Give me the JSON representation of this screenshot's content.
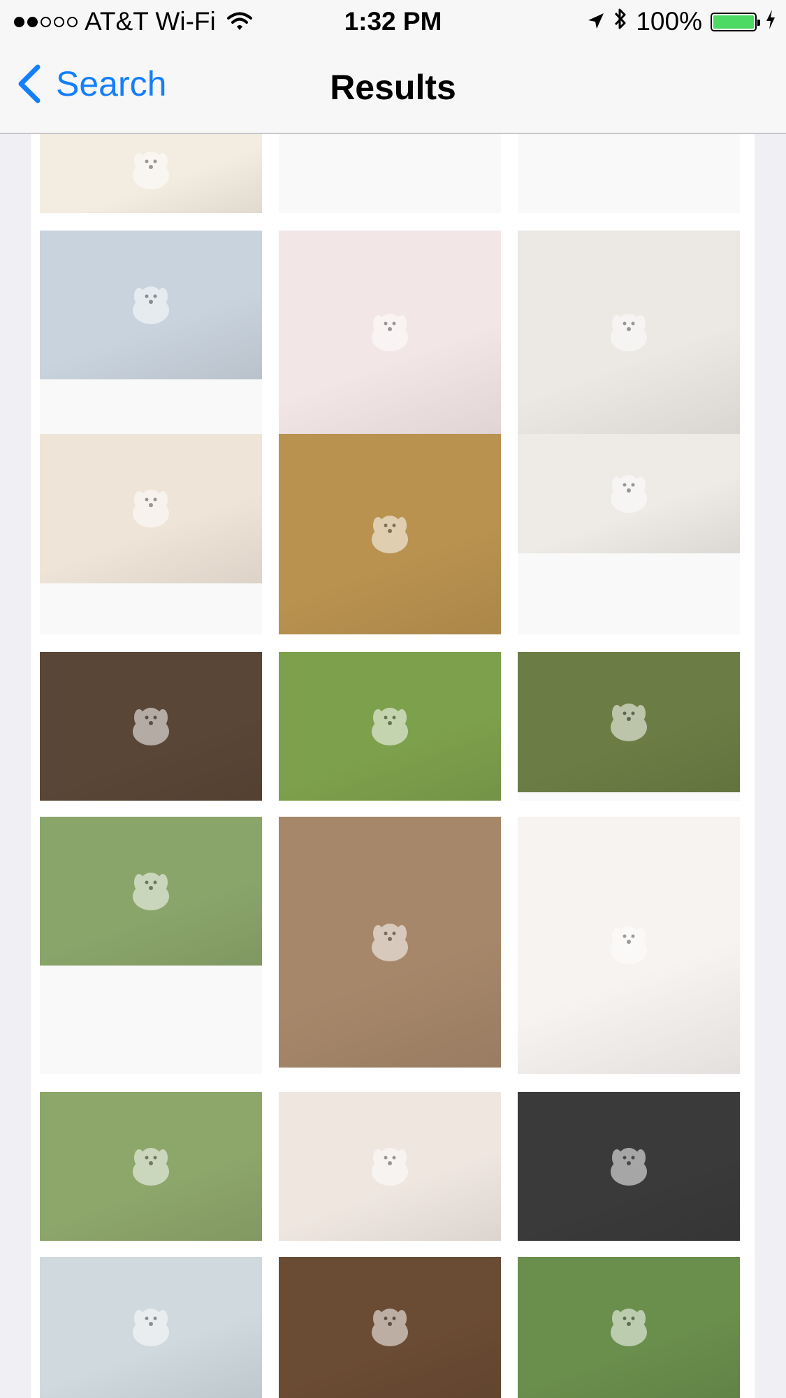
{
  "status_bar": {
    "carrier": "AT&T Wi-Fi",
    "time": "1:32 PM",
    "battery": "100%",
    "signal_bars_filled": 2,
    "signal_bars_total": 5
  },
  "nav_bar": {
    "back_label": "Search",
    "title": "Results"
  },
  "colors": {
    "accent": "#147efb",
    "battery": "#4cd964",
    "page_bg": "#efeff4"
  },
  "results": [
    {
      "name": "puppy-sitting-cream",
      "icon": "dog-icon"
    },
    {
      "name": "placeholder-blank-1",
      "icon": "dog-icon"
    },
    {
      "name": "placeholder-blank-2",
      "icon": "dog-icon"
    },
    {
      "name": "beagle-puppy",
      "icon": "dog-icon"
    },
    {
      "name": "labrador-puppies-in-basket",
      "icon": "dog-icon"
    },
    {
      "name": "australian-shepherd-puppy",
      "icon": "dog-icon"
    },
    {
      "name": "sleeping-puppies",
      "icon": "dog-icon"
    },
    {
      "name": "golden-retriever-with-puppies",
      "icon": "dog-icon"
    },
    {
      "name": "kitten-and-puppy",
      "icon": "dog-icon"
    },
    {
      "name": "golden-retriever-lying",
      "icon": "dog-icon"
    },
    {
      "name": "golden-puppy-in-grass",
      "icon": "dog-icon"
    },
    {
      "name": "brown-poodle-puppy",
      "icon": "dog-icon"
    },
    {
      "name": "jack-russell-puppy-grass",
      "icon": "dog-icon"
    },
    {
      "name": "french-bulldog-puppy",
      "icon": "dog-icon"
    },
    {
      "name": "cartoon-maltese-puppy",
      "icon": "dog-icon"
    },
    {
      "name": "husky-puppy",
      "icon": "dog-icon"
    },
    {
      "name": "bulldog-puppy-over-edge",
      "icon": "dog-icon"
    },
    {
      "name": "black-dog-in-hood",
      "icon": "dog-icon"
    },
    {
      "name": "newborn-puppy-in-hand",
      "icon": "dog-icon"
    },
    {
      "name": "jack-russell-with-leash",
      "icon": "dog-icon"
    },
    {
      "name": "white-puppies-running",
      "icon": "dog-icon"
    }
  ]
}
